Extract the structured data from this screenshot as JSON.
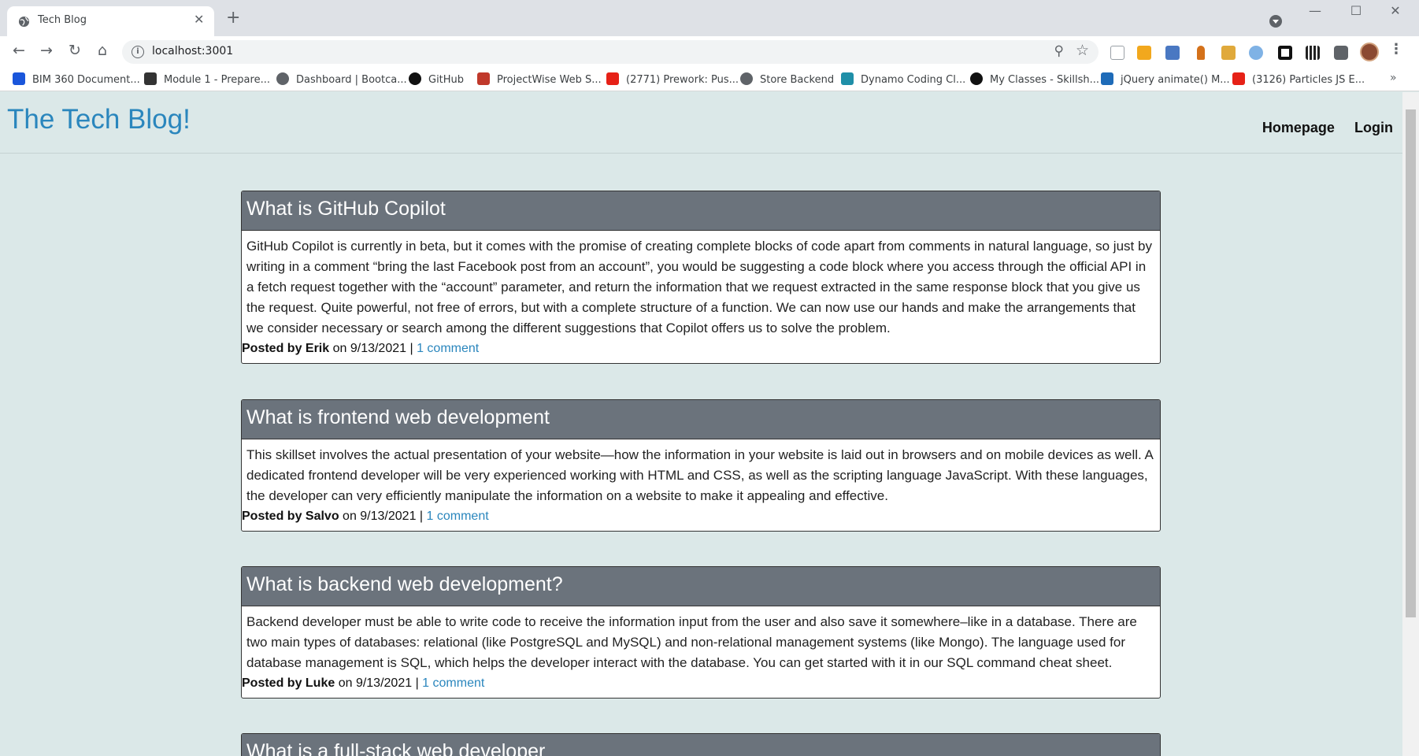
{
  "browser": {
    "tab_title": "Tech Blog",
    "tab_close": "✕",
    "new_tab": "+",
    "url": "localhost:3001",
    "bookmarks": [
      {
        "label": "BIM 360 Document...",
        "color": "#1a56db"
      },
      {
        "label": "Module 1 - Prepare...",
        "color": "#333333"
      },
      {
        "label": "Dashboard | Bootca...",
        "color": "#5f6368"
      },
      {
        "label": "GitHub",
        "color": "#111111"
      },
      {
        "label": "ProjectWise Web S...",
        "color": "#c0392b"
      },
      {
        "label": "(2771) Prework: Pus...",
        "color": "#e62117"
      },
      {
        "label": "Store Backend",
        "color": "#5f6368"
      },
      {
        "label": "Dynamo Coding Cl...",
        "color": "#1f8fa8"
      },
      {
        "label": "My Classes - Skillsh...",
        "color": "#111111"
      },
      {
        "label": "jQuery animate() M...",
        "color": "#1e6bb8"
      },
      {
        "label": "(3126) Particles JS E...",
        "color": "#e62117"
      }
    ],
    "bookmarks_more": "»"
  },
  "site": {
    "title": "The Tech Blog!",
    "nav": {
      "homepage": "Homepage",
      "login": "Login"
    }
  },
  "posts": [
    {
      "title": "What is GitHub Copilot",
      "body": "GitHub Copilot is currently in beta, but it comes with the promise of creating complete blocks of code apart from comments in natural language, so just by writing in a comment “bring the last Facebook post from an account”, you would be suggesting a code block where you access through the official API in a fetch request together with the “account” parameter, and return the information that we request extracted in the same response block that you give us the request. Quite powerful, not free of errors, but with a complete structure of a function. We can now use our hands and make the arrangements that we consider necessary or search among the different suggestions that Copilot offers us to solve the problem.",
      "posted_by": "Posted by Erik",
      "date": " on 9/13/2021 | ",
      "comments": "1 comment"
    },
    {
      "title": "What is frontend web development",
      "body": "This skillset involves the actual presentation of your website—how the information in your website is laid out in browsers and on mobile devices as well. A dedicated frontend developer will be very experienced working with HTML and CSS, as well as the scripting language JavaScript. With these languages, the developer can very efficiently manipulate the information on a website to make it appealing and effective.",
      "posted_by": "Posted by Salvo",
      "date": " on 9/13/2021 | ",
      "comments": "1 comment"
    },
    {
      "title": "What is backend web development?",
      "body": "Backend developer must be able to write code to receive the information input from the user and also save it somewhere–like in a database. There are two main types of databases: relational (like PostgreSQL and MySQL) and non-relational management systems (like Mongo). The language used for database management is SQL, which helps the developer interact with the database. You can get started with it in our SQL command cheat sheet.",
      "posted_by": "Posted by Luke",
      "date": " on 9/13/2021 | ",
      "comments": "1 comment"
    },
    {
      "title": "What is a full-stack web developer"
    }
  ]
}
